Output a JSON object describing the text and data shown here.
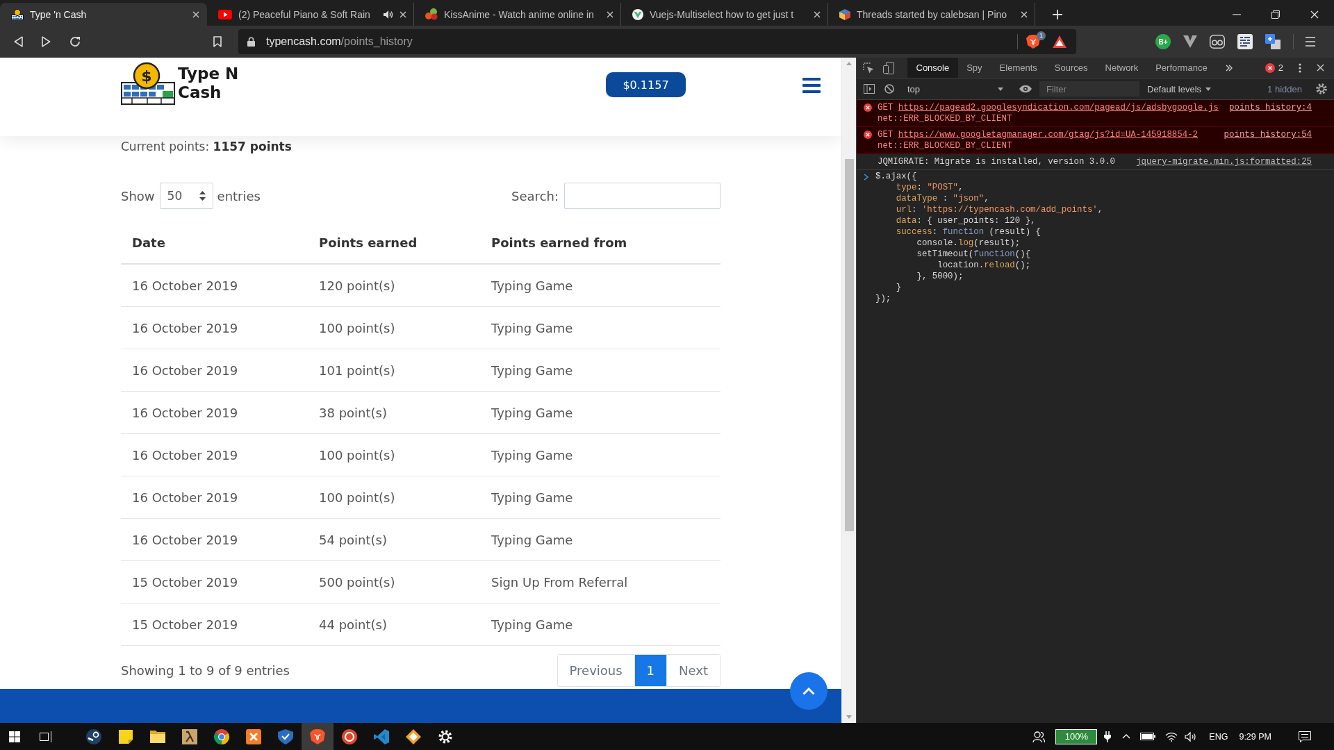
{
  "browser": {
    "tabs": [
      {
        "title": "Type 'n Cash",
        "favicon": {
          "kind": "coin"
        },
        "audio": false,
        "selected": true
      },
      {
        "title": "(2) Peaceful Piano & Soft Rain",
        "favicon": {
          "kind": "play"
        },
        "audio": true,
        "selected": false
      },
      {
        "title": "KissAnime - Watch anime online in",
        "favicon": {
          "kind": "circles"
        },
        "audio": false,
        "selected": false
      },
      {
        "title": "Vuejs-Multiselect how to get just t",
        "favicon": {
          "kind": "v"
        },
        "audio": false,
        "selected": false
      },
      {
        "title": "Threads started by calebsan | Pino",
        "favicon": {
          "kind": "cube"
        },
        "audio": false,
        "selected": false
      }
    ],
    "address": {
      "host": "typencash.com",
      "path": "/points_history",
      "icons": [
        {
          "kind": "lion",
          "badge": "1"
        },
        {
          "kind": "triangle"
        }
      ]
    },
    "extensions": [
      {
        "kind": "label",
        "label": "B+"
      },
      {
        "kind": "v"
      },
      {
        "kind": "glasses"
      },
      {
        "kind": "binary"
      },
      {
        "kind": "translate"
      }
    ]
  },
  "page": {
    "logo": {
      "symbol": "$",
      "lines": [
        "Type N",
        "Cash"
      ]
    },
    "balance": "$0.1157",
    "current_points": "Current points: **1157 points**",
    "length_menu": {
      "before": "Show",
      "value": "50",
      "after": "entries"
    },
    "search": {
      "label": "Search:"
    },
    "table": {
      "columns": [
        "Date",
        "Points earned",
        "Points earned from"
      ],
      "rows": [
        [
          "16 October 2019",
          "120 point(s)",
          "Typing Game"
        ],
        [
          "16 October 2019",
          "100 point(s)",
          "Typing Game"
        ],
        [
          "16 October 2019",
          "101 point(s)",
          "Typing Game"
        ],
        [
          "16 October 2019",
          "38 point(s)",
          "Typing Game"
        ],
        [
          "16 October 2019",
          "100 point(s)",
          "Typing Game"
        ],
        [
          "16 October 2019",
          "100 point(s)",
          "Typing Game"
        ],
        [
          "16 October 2019",
          "54 point(s)",
          "Typing Game"
        ],
        [
          "15 October 2019",
          "500 point(s)",
          "Sign Up From Referral"
        ],
        [
          "15 October 2019",
          "44 point(s)",
          "Typing Game"
        ]
      ]
    },
    "info": "Showing 1 to 9 of 9 entries",
    "pagination": [
      {
        "label": "Previous",
        "selected": false
      },
      {
        "label": "1",
        "selected": true
      },
      {
        "label": "Next",
        "selected": false
      }
    ]
  },
  "devtools": {
    "tabs": [
      {
        "label": "Console",
        "selected": true
      },
      {
        "label": "Spy",
        "selected": false
      },
      {
        "label": "Elements",
        "selected": false
      },
      {
        "label": "Sources",
        "selected": false
      },
      {
        "label": "Network",
        "selected": false
      },
      {
        "label": "Performance",
        "selected": false
      }
    ],
    "error_count": "2",
    "context": "top",
    "filter": {
      "placeholder": "Filter"
    },
    "levels": "Default levels",
    "hidden": "1 hidden",
    "messages": [
      {
        "kind": "error",
        "method": "GET",
        "url": "https://pagead2.googlesyndication.com/pagead/js/adsbygoogle.js",
        "detail": "net::ERR_BLOCKED_BY_CLIENT",
        "source": "points_history:4"
      },
      {
        "kind": "error",
        "method": "GET",
        "url": "https://www.googletagmanager.com/gtag/js?id=UA-145918854-2",
        "detail": "net::ERR_BLOCKED_BY_CLIENT",
        "source": "points_history:54"
      },
      {
        "kind": "info",
        "text": "JQMIGRATE: Migrate is installed, version 3.0.0",
        "source": "jquery-migrate.min.js:formatted:25"
      }
    ],
    "input": [
      [
        {
          "kind": "plain",
          "text": "$.ajax({"
        }
      ],
      [
        {
          "kind": "property",
          "text": "    type"
        },
        {
          "kind": "plain",
          "text": ": "
        },
        {
          "kind": "string",
          "text": "\"POST\""
        },
        {
          "kind": "plain",
          "text": ","
        }
      ],
      [
        {
          "kind": "property",
          "text": "    dataType"
        },
        {
          "kind": "plain",
          "text": " : "
        },
        {
          "kind": "string",
          "text": "\"json\""
        },
        {
          "kind": "plain",
          "text": ","
        }
      ],
      [
        {
          "kind": "property",
          "text": "    url"
        },
        {
          "kind": "plain",
          "text": ": "
        },
        {
          "kind": "string",
          "text": "'https://typencash.com/add_points'"
        },
        {
          "kind": "plain",
          "text": ","
        }
      ],
      [
        {
          "kind": "property",
          "text": "    data"
        },
        {
          "kind": "plain",
          "text": ": { user_points: 120 },"
        }
      ],
      [
        {
          "kind": "property",
          "text": "    success"
        },
        {
          "kind": "plain",
          "text": ": "
        },
        {
          "kind": "keyword",
          "text": "function"
        },
        {
          "kind": "plain",
          "text": " (result) {"
        }
      ],
      [
        {
          "kind": "plain",
          "text": "        console."
        },
        {
          "kind": "method",
          "text": "log"
        },
        {
          "kind": "plain",
          "text": "(result);"
        }
      ],
      [
        {
          "kind": "plain",
          "text": "        setTimeout("
        },
        {
          "kind": "keyword",
          "text": "function"
        },
        {
          "kind": "plain",
          "text": "(){"
        }
      ],
      [
        {
          "kind": "plain",
          "text": "            location."
        },
        {
          "kind": "method",
          "text": "reload"
        },
        {
          "kind": "plain",
          "text": "();"
        }
      ],
      [
        {
          "kind": "plain",
          "text": "        }, 5000);"
        }
      ],
      [
        {
          "kind": "plain",
          "text": "    }"
        }
      ],
      [
        {
          "kind": "plain",
          "text": "});"
        }
      ]
    ]
  },
  "taskbar": {
    "apps": [
      {
        "kind": "lever",
        "selected": false
      },
      {
        "kind": "note",
        "selected": false
      },
      {
        "kind": "folder",
        "selected": false
      },
      {
        "kind": "lambda",
        "selected": false
      },
      {
        "kind": "segments",
        "selected": false
      },
      {
        "kind": "square",
        "selected": false
      },
      {
        "kind": "shield",
        "selected": false
      },
      {
        "kind": "lion",
        "selected": true
      },
      {
        "kind": "emblem",
        "selected": false
      },
      {
        "kind": "ribbon",
        "selected": false
      },
      {
        "kind": "diamond",
        "selected": false
      },
      {
        "kind": "gear",
        "selected": false
      }
    ],
    "battery": "100%",
    "language": "ENG",
    "time": "9:29 PM"
  }
}
